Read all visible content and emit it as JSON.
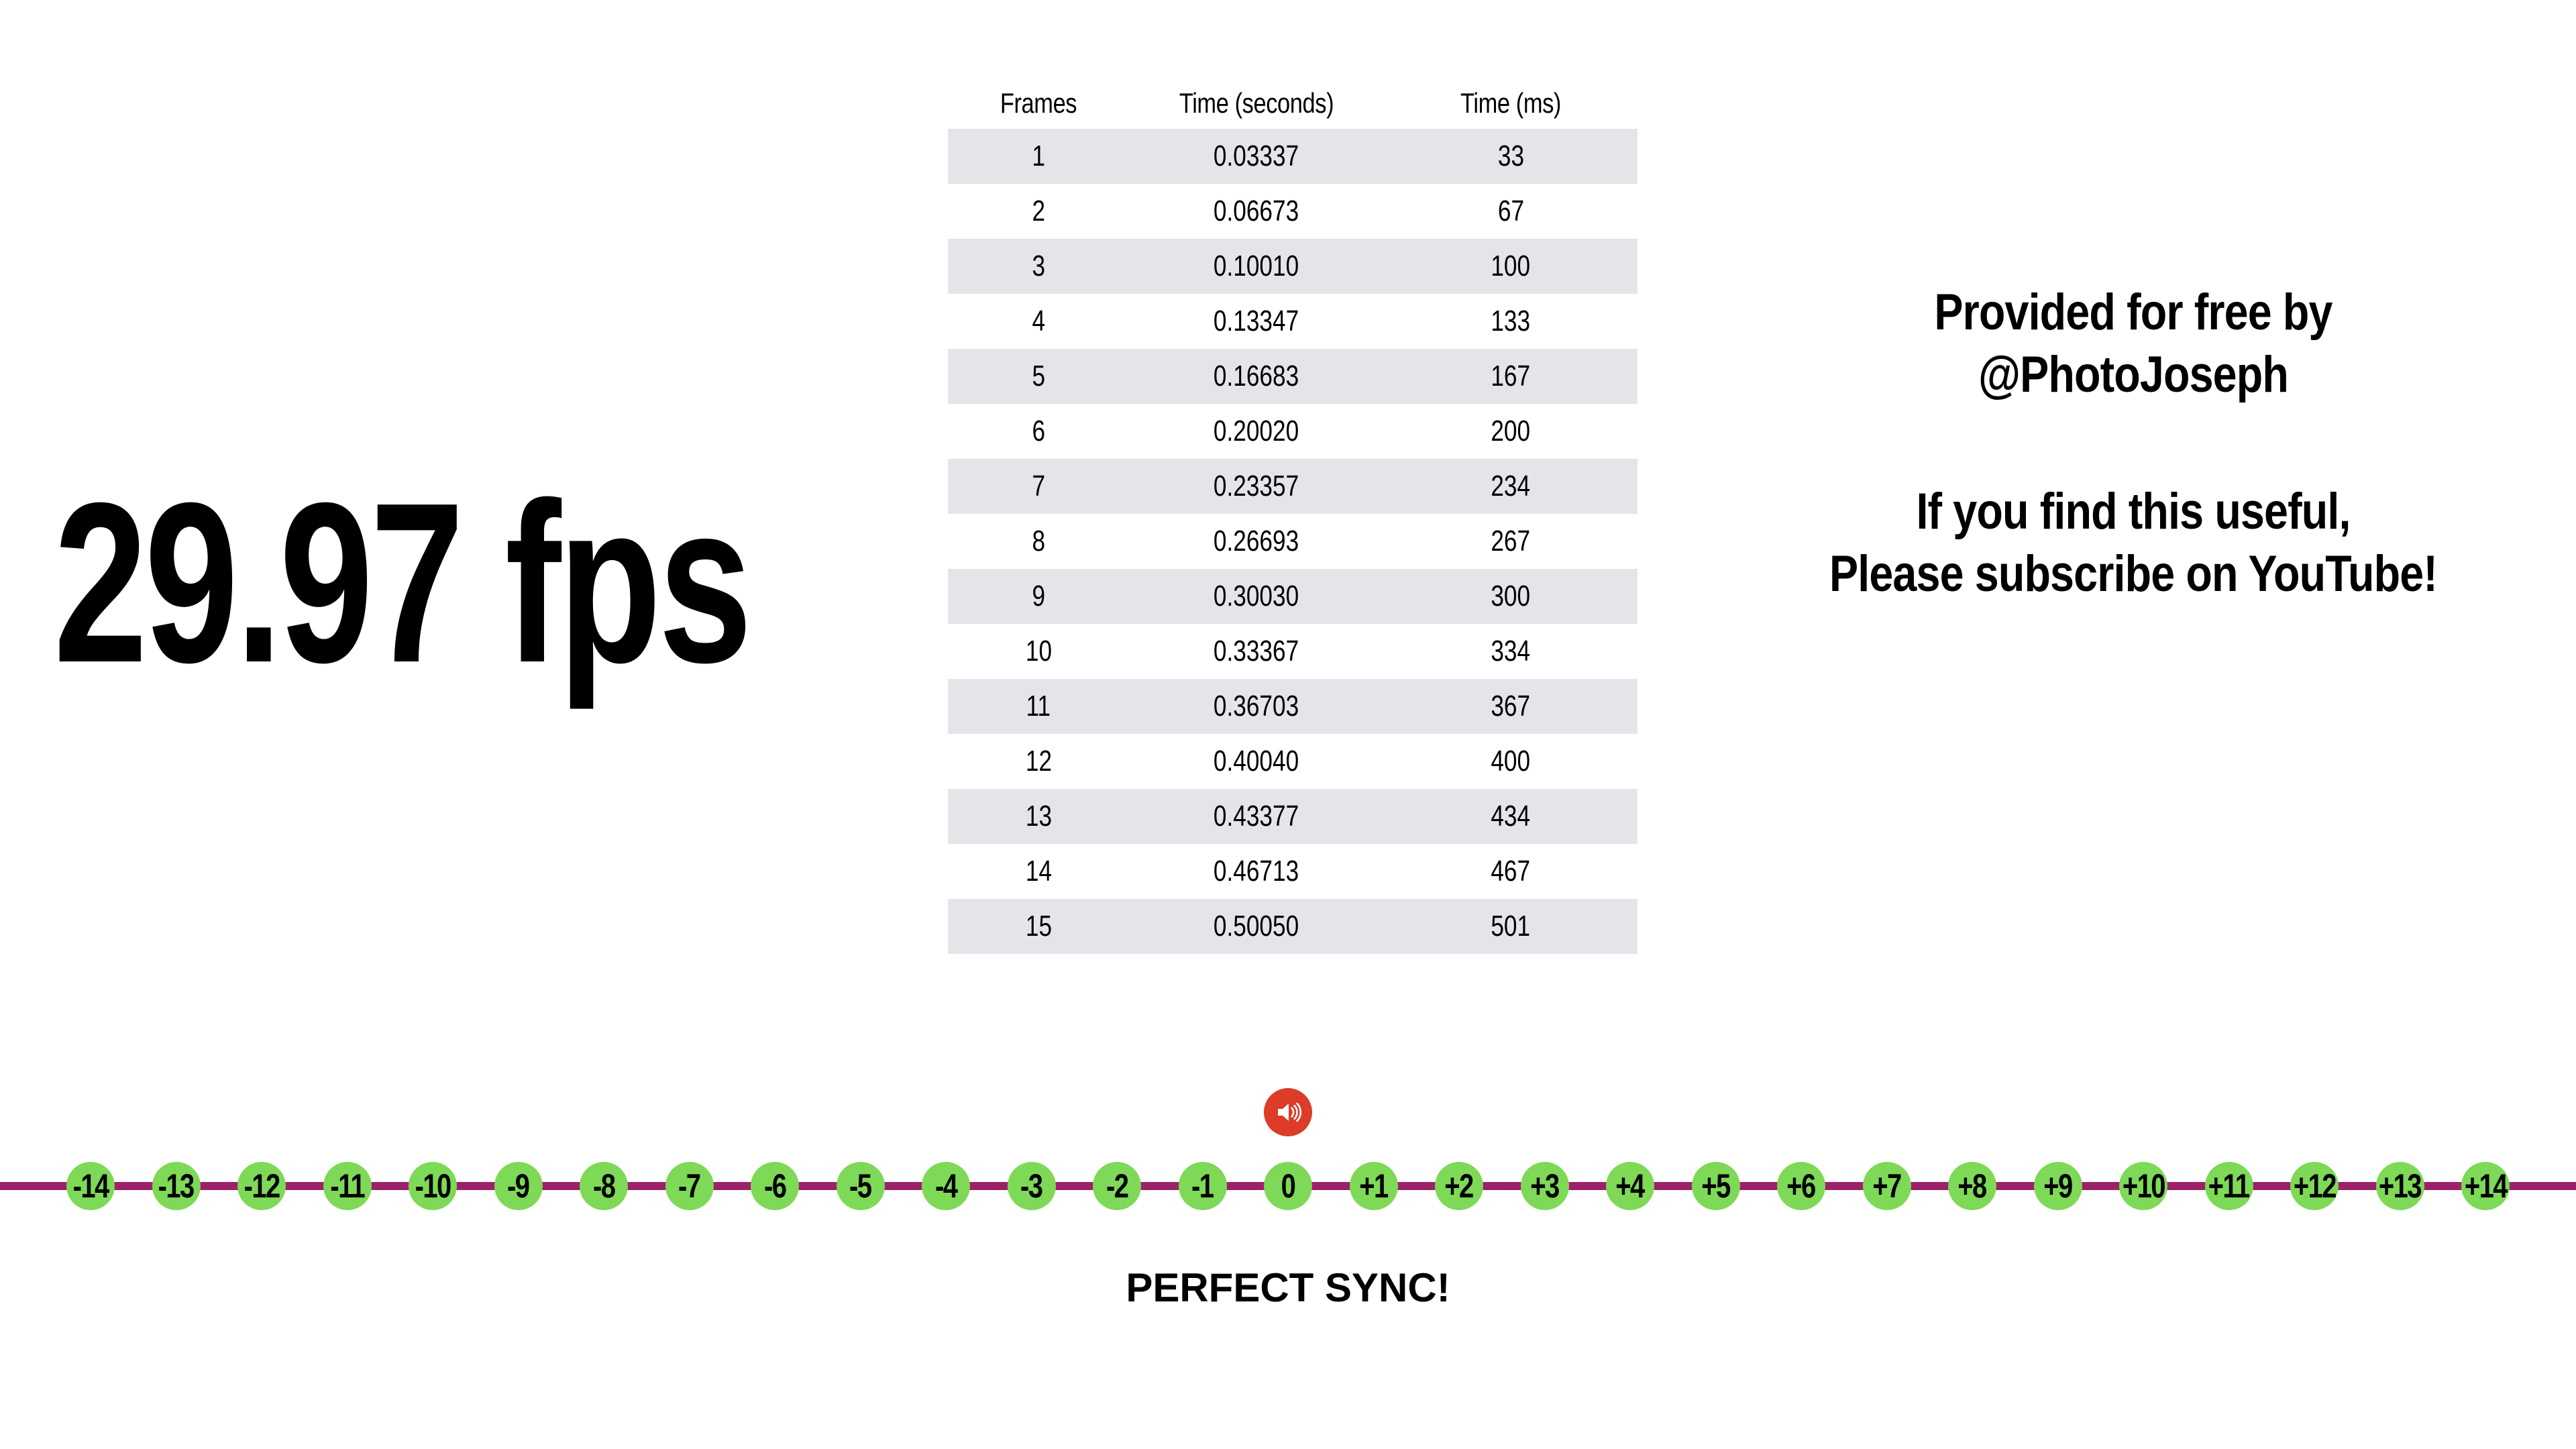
{
  "headline": {
    "fps_label": "29.97 fps"
  },
  "table": {
    "columns": [
      "Frames",
      "Time (seconds)",
      "Time (ms)"
    ],
    "rows": [
      {
        "frame": "1",
        "seconds": "0.03337",
        "ms": "33"
      },
      {
        "frame": "2",
        "seconds": "0.06673",
        "ms": "67"
      },
      {
        "frame": "3",
        "seconds": "0.10010",
        "ms": "100"
      },
      {
        "frame": "4",
        "seconds": "0.13347",
        "ms": "133"
      },
      {
        "frame": "5",
        "seconds": "0.16683",
        "ms": "167"
      },
      {
        "frame": "6",
        "seconds": "0.20020",
        "ms": "200"
      },
      {
        "frame": "7",
        "seconds": "0.23357",
        "ms": "234"
      },
      {
        "frame": "8",
        "seconds": "0.26693",
        "ms": "267"
      },
      {
        "frame": "9",
        "seconds": "0.30030",
        "ms": "300"
      },
      {
        "frame": "10",
        "seconds": "0.33367",
        "ms": "334"
      },
      {
        "frame": "11",
        "seconds": "0.36703",
        "ms": "367"
      },
      {
        "frame": "12",
        "seconds": "0.40040",
        "ms": "400"
      },
      {
        "frame": "13",
        "seconds": "0.43377",
        "ms": "434"
      },
      {
        "frame": "14",
        "seconds": "0.46713",
        "ms": "467"
      },
      {
        "frame": "15",
        "seconds": "0.50050",
        "ms": "501"
      }
    ]
  },
  "promo": {
    "line1": "Provided for free by",
    "line2": "@PhotoJoseph",
    "line3": "If you find this useful,",
    "line4": "Please subscribe on YouTube!"
  },
  "timeline": {
    "markers": [
      "-14",
      "-13",
      "-12",
      "-11",
      "-10",
      "-9",
      "-8",
      "-7",
      "-6",
      "-5",
      "-4",
      "-3",
      "-2",
      "-1",
      "0",
      "+1",
      "+2",
      "+3",
      "+4",
      "+5",
      "+6",
      "+7",
      "+8",
      "+9",
      "+10",
      "+11",
      "+12",
      "+13",
      "+14"
    ],
    "center_index": 14,
    "status_label": "PERFECT SYNC!",
    "audio_icon": "speaker-volume-icon",
    "line_color": "#9c2169",
    "marker_color": "#7ed957",
    "marker_text_color": "#000000",
    "audio_icon_color": "#dc3c28"
  },
  "colors": {
    "background": "#ffffff",
    "text": "#000000",
    "table_stripe": "#e3e5e9",
    "accent_green": "#7ed957",
    "accent_magenta": "#9c2169",
    "accent_red": "#dc3c28"
  }
}
